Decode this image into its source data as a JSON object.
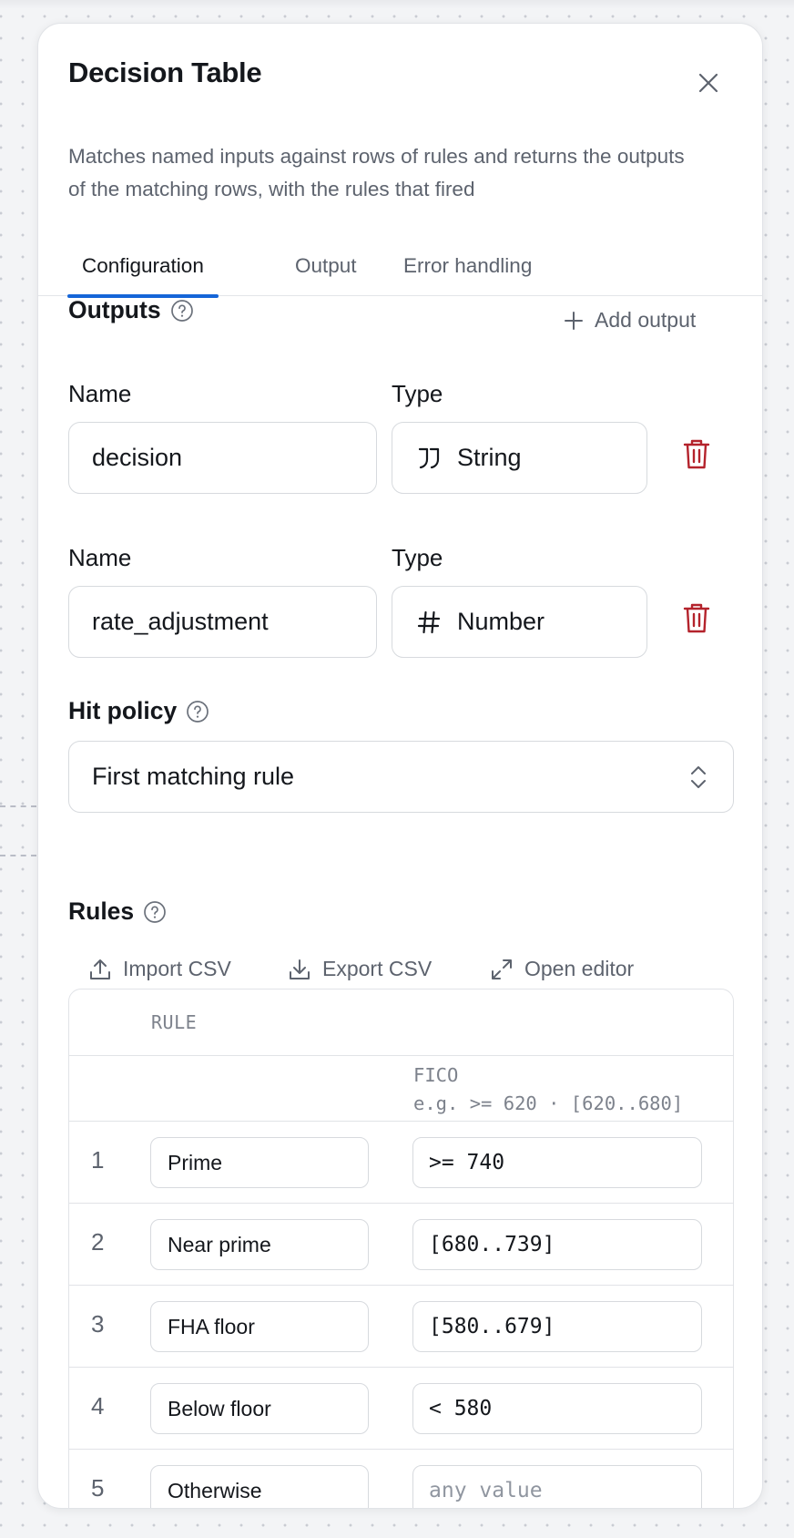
{
  "panel": {
    "title": "Decision Table",
    "description": "Matches named inputs against rows of rules and returns the outputs of the matching rows, with the rules that fired"
  },
  "tabs": [
    {
      "label": "Configuration",
      "active": true
    },
    {
      "label": "Output",
      "active": false
    },
    {
      "label": "Error handling",
      "active": false
    }
  ],
  "outputs": {
    "title": "Outputs",
    "add_label": "Add output",
    "name_label": "Name",
    "type_label": "Type",
    "items": [
      {
        "name": "decision",
        "type": "String",
        "type_icon": "quote-icon"
      },
      {
        "name": "rate_adjustment",
        "type": "Number",
        "type_icon": "hash-icon"
      }
    ]
  },
  "hit_policy": {
    "title": "Hit policy",
    "selected": "First matching rule"
  },
  "rules": {
    "title": "Rules",
    "actions": {
      "import": "Import CSV",
      "export": "Export CSV",
      "open_editor": "Open editor"
    },
    "header": "RULE",
    "column": {
      "title": "FICO",
      "hint": "e.g. >= 620 · [620..680]"
    },
    "rows": [
      {
        "num": "1",
        "name": "Prime",
        "condition": ">= 740"
      },
      {
        "num": "2",
        "name": "Near prime",
        "condition": "[680..739]"
      },
      {
        "num": "3",
        "name": "FHA floor",
        "condition": "[580..679]"
      },
      {
        "num": "4",
        "name": "Below floor",
        "condition": "< 580"
      },
      {
        "num": "5",
        "name": "Otherwise",
        "condition": "",
        "condition_placeholder": "any value"
      }
    ]
  },
  "colors": {
    "accent": "#1565d8",
    "danger": "#b4232c",
    "muted_text": "#5d636e"
  }
}
